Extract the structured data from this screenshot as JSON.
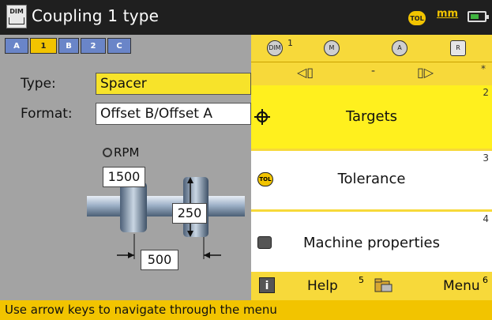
{
  "window": {
    "title": "Coupling 1 type",
    "title_icon_text": "DIM",
    "tolerance_badge": "TOL",
    "unit": "mm"
  },
  "tabs": [
    "A",
    "1",
    "B",
    "2",
    "C"
  ],
  "form": {
    "type_label": "Type:",
    "type_value": "Spacer",
    "format_label": "Format:",
    "format_value": "Offset B/Offset A"
  },
  "diagram": {
    "rpm_label": "RPM",
    "rpm_value": "1500",
    "diameter_value": "250",
    "spacer_length_value": "500"
  },
  "menu": {
    "icon_row_number": "1",
    "nav_row_markers": [
      "-",
      "*"
    ],
    "items": [
      {
        "label": "Targets",
        "number": "2",
        "icon": "target-crosshair-icon",
        "selected": true
      },
      {
        "label": "Tolerance",
        "number": "3",
        "icon": "tolerance-badge-icon",
        "selected": false
      },
      {
        "label": "Machine properties",
        "number": "4",
        "icon": "machine-icon",
        "selected": false
      }
    ],
    "help_label": "Help",
    "help_number": "5",
    "menu_label": "Menu",
    "menu_number": "6",
    "info_symbol": "i"
  },
  "status_text": "Use arrow keys to navigate through the menu",
  "colors": {
    "accent_yellow": "#f7d93a",
    "selected_yellow": "#fff01e",
    "tab_blue": "#6a85c8",
    "titlebar": "#1f1f1f"
  }
}
